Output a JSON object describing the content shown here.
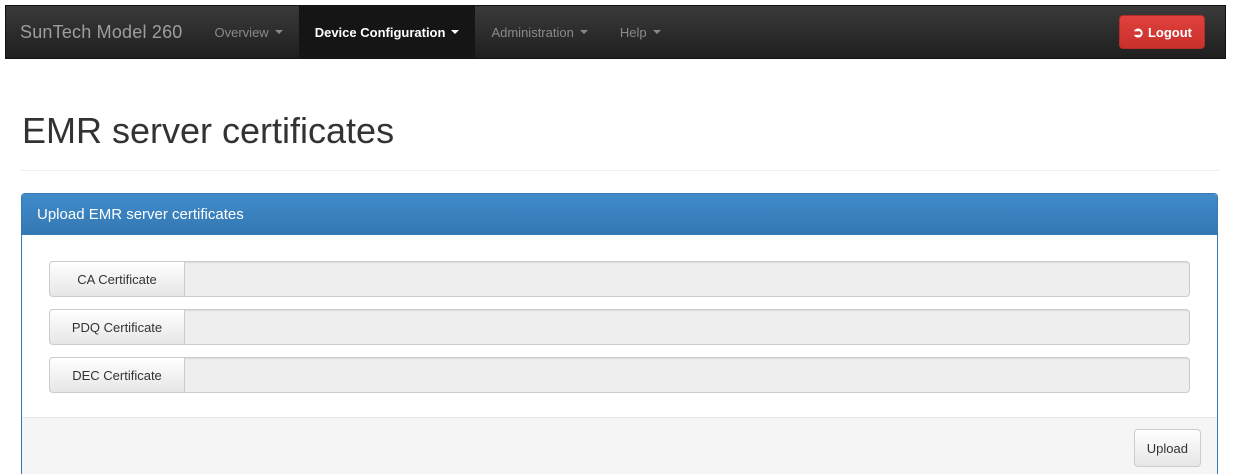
{
  "navbar": {
    "brand": "SunTech Model 260",
    "items": [
      {
        "label": "Overview",
        "active": false
      },
      {
        "label": "Device Configuration",
        "active": true
      },
      {
        "label": "Administration",
        "active": false
      },
      {
        "label": "Help",
        "active": false
      }
    ],
    "logout": {
      "label": "Logout",
      "icon": "logout-icon",
      "color": "#d9534f"
    }
  },
  "page": {
    "title": "EMR server certificates"
  },
  "panel": {
    "heading": "Upload EMR server certificates",
    "accent_color": "#337ab7",
    "fields": [
      {
        "button_label": "CA Certificate",
        "value": ""
      },
      {
        "button_label": "PDQ Certificate",
        "value": ""
      },
      {
        "button_label": "DEC Certificate",
        "value": ""
      }
    ],
    "upload_label": "Upload"
  }
}
